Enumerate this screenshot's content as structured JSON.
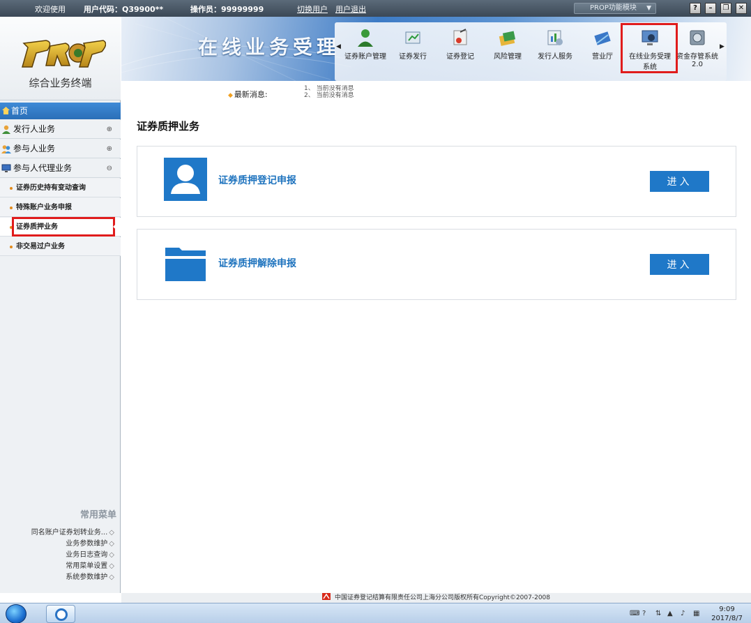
{
  "titlebar": {
    "welcome": "欢迎使用",
    "user_code_label": "用户代码：",
    "user_code_value": "Q39900**",
    "operator_label": "操作员：",
    "operator_value": "99999999",
    "switch_user": "切换用户",
    "logout": "用户退出",
    "module_select": "PROP功能模块",
    "window_buttons": [
      "?",
      "–",
      "❐",
      "✕"
    ]
  },
  "sidebar": {
    "logo_subtitle": "综合业务终端",
    "home": "首页",
    "nav": [
      {
        "label": "发行人业务",
        "toggle": "⊕"
      },
      {
        "label": "参与人业务",
        "toggle": "⊕"
      },
      {
        "label": "参与人代理业务",
        "toggle": "⊖"
      }
    ],
    "sub_items": [
      "证券历史持有变动查询",
      "特殊账户业务申报",
      "证券质押业务",
      "非交易过户业务"
    ],
    "favorites_title": "常用菜单",
    "favorites": [
      "同名账户证券划转业务...",
      "业务参数维护",
      "业务日志查询",
      "常用菜单设置",
      "系统参数维护"
    ]
  },
  "banner": {
    "title": "在线业务受理",
    "modules": [
      {
        "label": "证券账户管理",
        "label2": ""
      },
      {
        "label": "证券发行",
        "label2": ""
      },
      {
        "label": "证券登记",
        "label2": ""
      },
      {
        "label": "风险管理",
        "label2": ""
      },
      {
        "label": "发行人服务",
        "label2": ""
      },
      {
        "label": "营业厅",
        "label2": ""
      },
      {
        "label": "在线业务受理",
        "label2": "系统"
      },
      {
        "label": "资金存管系统",
        "label2": "2.0"
      }
    ]
  },
  "news": {
    "label": "最新消息:",
    "line1": "1、 当前没有消息",
    "line2": "2、 当前没有消息"
  },
  "main": {
    "title": "证券质押业务",
    "cards": [
      {
        "label": "证券质押登记申报",
        "button": "进入"
      },
      {
        "label": "证券质押解除申报",
        "button": "进入"
      }
    ]
  },
  "footer": {
    "text": "中国证券登记结算有限责任公司上海分公司版权所有Copyright©2007-2008"
  },
  "taskbar": {
    "time": "9:09",
    "date": "2017/8/7"
  },
  "colors": {
    "accent_blue": "#1f78c8",
    "highlight_red": "#e01c1c",
    "home_bar": "#2a6fb8"
  }
}
